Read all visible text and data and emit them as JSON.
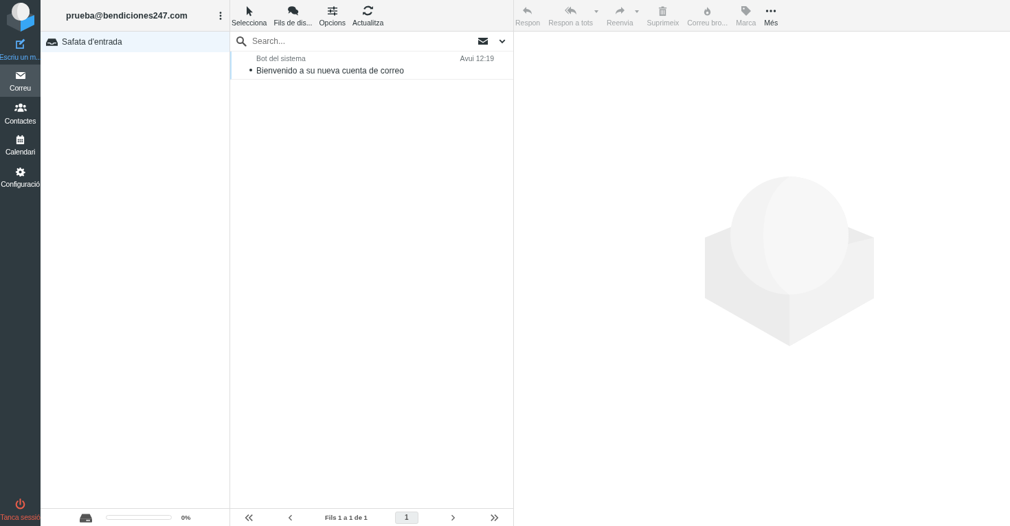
{
  "nav": {
    "compose": "Escriu un m...",
    "items": [
      {
        "label": "Correu",
        "kind": "mail",
        "selected": true
      },
      {
        "label": "Contactes",
        "kind": "users",
        "selected": false
      },
      {
        "label": "Calendari",
        "kind": "calendar",
        "selected": false
      },
      {
        "label": "Configuració",
        "kind": "gear",
        "selected": false
      }
    ],
    "logout": "Tanca sessió"
  },
  "folders": {
    "account": "prueba@bendiciones247.com",
    "items": [
      {
        "name": "Safata d'entrada",
        "selected": true
      }
    ],
    "quota": {
      "level": 0,
      "reading": "0%"
    }
  },
  "list": {
    "toolbar": [
      {
        "label": "Selecciona",
        "kind": "pointer"
      },
      {
        "label": "Fils de dis...",
        "kind": "chat"
      },
      {
        "label": "Opcions",
        "kind": "sliders"
      },
      {
        "label": "Actualitza",
        "kind": "refresh"
      }
    ],
    "search": {
      "placeholder": "Search..."
    },
    "messages": [
      {
        "from": "Bot del sistema",
        "date": "Avui 12:19",
        "subject": "Bienvenido a su nueva cuenta de correo",
        "unread": true,
        "selected": true
      }
    ],
    "pagination": {
      "info": "Fils 1 a 1 de 1",
      "page": "1"
    }
  },
  "preview": {
    "toolbar": [
      {
        "label": "Respon",
        "kind": "reply",
        "disabled": true,
        "dropdown": false
      },
      {
        "label": "Respon a tots",
        "kind": "reply-all",
        "disabled": true,
        "dropdown": true
      },
      {
        "label": "Reenvia",
        "kind": "forward",
        "disabled": true,
        "dropdown": true
      },
      {
        "label": "Suprimeix",
        "kind": "trash",
        "disabled": true,
        "dropdown": false
      },
      {
        "label": "Correu bro...",
        "kind": "fire",
        "disabled": true,
        "dropdown": false
      },
      {
        "label": "Marca",
        "kind": "tag",
        "disabled": true,
        "dropdown": false
      },
      {
        "label": "Més",
        "kind": "dots",
        "disabled": false,
        "dropdown": false
      }
    ]
  }
}
